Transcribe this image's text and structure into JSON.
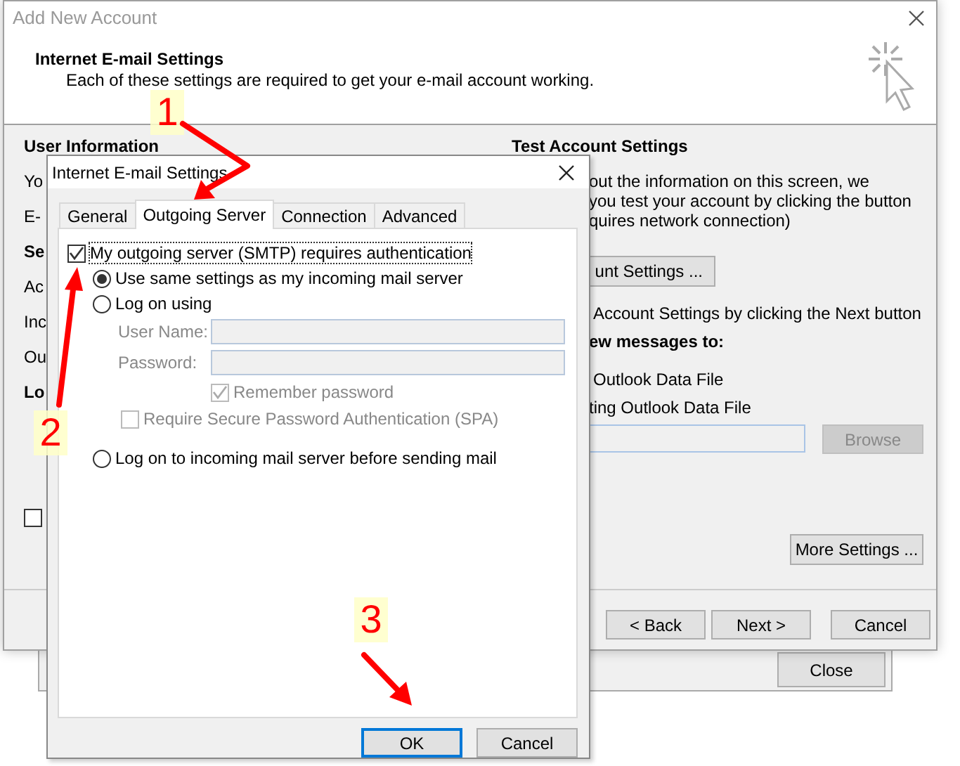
{
  "main_window": {
    "title": "Add New Account",
    "header_title": "Internet E-mail Settings",
    "header_subtitle": "Each of these settings are required to get your e-mail account working.",
    "left_column": [
      {
        "kind": "heading",
        "text": "User Information"
      },
      {
        "kind": "label",
        "text": "Yo"
      },
      {
        "kind": "label",
        "text": "E-"
      },
      {
        "kind": "heading",
        "text": "Se"
      },
      {
        "kind": "label",
        "text": "Ac"
      },
      {
        "kind": "label",
        "text": "Inc"
      },
      {
        "kind": "label",
        "text": "Ou"
      },
      {
        "kind": "heading",
        "text": "Lo"
      }
    ],
    "left_checkbox": {
      "checked": false
    },
    "right_column": {
      "heading": "Test Account Settings",
      "paragraph": [
        "out the information on this screen, we",
        "you test your account by clicking the button",
        "quires network connection)"
      ],
      "test_button": "unt Settings ...",
      "next_note": "Account Settings by clicking the Next button",
      "deliver_heading": "ew messages to:",
      "option_new": "Outlook Data File",
      "option_existing": "ting Outlook Data File",
      "browse_button": {
        "label": "Browse",
        "disabled": true
      },
      "more_settings_button": "More Settings ..."
    },
    "footer_buttons": [
      "< Back",
      "Next >",
      "Cancel"
    ]
  },
  "back_window": {
    "close_button": "Close"
  },
  "dialog": {
    "title": "Internet E-mail Settings",
    "tabs": [
      {
        "label": "General",
        "selected": false
      },
      {
        "label": "Outgoing Server",
        "selected": true
      },
      {
        "label": "Connection",
        "selected": false
      },
      {
        "label": "Advanced",
        "selected": false
      }
    ],
    "smtp_auth": {
      "label": "My outgoing server (SMTP) requires authentication",
      "checked": true
    },
    "auth_options": [
      {
        "label": "Use same settings as my incoming mail server",
        "selected": true
      },
      {
        "label": "Log on using",
        "selected": false
      }
    ],
    "fields": [
      {
        "label": "User Name:"
      },
      {
        "label": "Password:"
      }
    ],
    "remember_password": {
      "label": "Remember password",
      "checked": true,
      "disabled": true
    },
    "spa": {
      "label": "Require Secure Password Authentication (SPA)",
      "checked": false,
      "disabled": true
    },
    "pop_before_smtp": {
      "label": "Log on to incoming mail server before sending mail",
      "selected": false
    },
    "buttons": [
      {
        "label": "OK",
        "default": true
      },
      {
        "label": "Cancel",
        "default": false
      }
    ]
  },
  "annotations": [
    {
      "label": "1"
    },
    {
      "label": "2"
    },
    {
      "label": "3"
    }
  ]
}
